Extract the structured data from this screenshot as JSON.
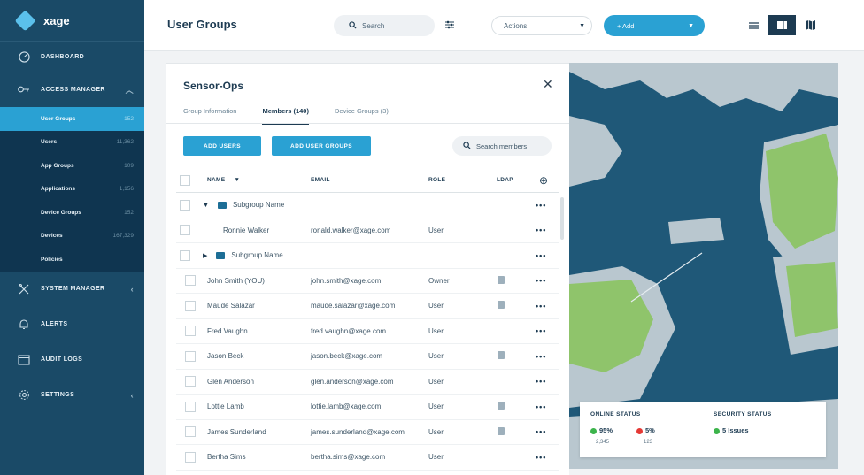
{
  "app": {
    "name": "xage"
  },
  "sidebar": {
    "dashboard": "DASHBOARD",
    "access_manager": "ACCESS MANAGER",
    "sub_items": [
      {
        "label": "User Groups",
        "count": "152",
        "active": true
      },
      {
        "label": "Users",
        "count": "11,362"
      },
      {
        "label": "App Groups",
        "count": "109"
      },
      {
        "label": "Applications",
        "count": "1,156"
      },
      {
        "label": "Device Groups",
        "count": "152"
      },
      {
        "label": "Devices",
        "count": "167,329"
      },
      {
        "label": "Policies",
        "count": ""
      }
    ],
    "system_manager": "SYSTEM MANAGER",
    "alerts": "ALERTS",
    "audit_logs": "AUDIT LOGS",
    "settings": "SETTINGS"
  },
  "header": {
    "title": "User Groups",
    "search_label": "Search",
    "actions_label": "Actions",
    "add_label": "+ Add"
  },
  "group": {
    "title": "Sensor-Ops",
    "tabs": [
      "Group Information",
      "Members (140)",
      "Device Groups (3)"
    ],
    "add_users": "ADD USERS",
    "add_user_groups": "ADD USER GROUPS",
    "search_members": "Search members",
    "columns": {
      "name": "NAME",
      "email": "EMAIL",
      "role": "ROLE",
      "ldap": "LDAP"
    },
    "rows": [
      {
        "kind": "subgroup",
        "expanded": true,
        "name": "Subgroup Name",
        "email": "",
        "role": "",
        "ldap": false
      },
      {
        "kind": "nested",
        "name": "Ronnie Walker",
        "email": "ronald.walker@xage.com",
        "role": "User",
        "ldap": false
      },
      {
        "kind": "subgroup",
        "expanded": false,
        "name": "Subgroup Name",
        "email": "",
        "role": "",
        "ldap": false
      },
      {
        "kind": "user",
        "name": "John Smith (YOU)",
        "email": "john.smith@xage.com",
        "role": "Owner",
        "ldap": true
      },
      {
        "kind": "user",
        "name": "Maude Salazar",
        "email": "maude.salazar@xage.com",
        "role": "User",
        "ldap": true
      },
      {
        "kind": "user",
        "name": "Fred Vaughn",
        "email": "fred.vaughn@xage.com",
        "role": "User",
        "ldap": false
      },
      {
        "kind": "user",
        "name": "Jason Beck",
        "email": "jason.beck@xage.com",
        "role": "User",
        "ldap": true
      },
      {
        "kind": "user",
        "name": "Glen Anderson",
        "email": "glen.anderson@xage.com",
        "role": "User",
        "ldap": false
      },
      {
        "kind": "user",
        "name": "Lottie Lamb",
        "email": "lottie.lamb@xage.com",
        "role": "User",
        "ldap": true
      },
      {
        "kind": "user",
        "name": "James Sunderland",
        "email": "james.sunderland@xage.com",
        "role": "User",
        "ldap": true
      },
      {
        "kind": "user",
        "name": "Bertha Sims",
        "email": "bertha.sims@xage.com",
        "role": "User",
        "ldap": false
      }
    ]
  },
  "map_status": {
    "online_title": "ONLINE STATUS",
    "online_pct": "95%",
    "online_count": "2,345",
    "offline_pct": "5%",
    "offline_count": "123",
    "security_title": "SECURITY STATUS",
    "security_issues": "5 Issues",
    "colors": {
      "online": "#3cb44b",
      "offline": "#e53935",
      "security": "#3cb44b"
    }
  },
  "colors": {
    "accent": "#2aa1d3",
    "sidebar": "#1a4a67",
    "water": "#1f5878",
    "land": "#8fc46b"
  }
}
